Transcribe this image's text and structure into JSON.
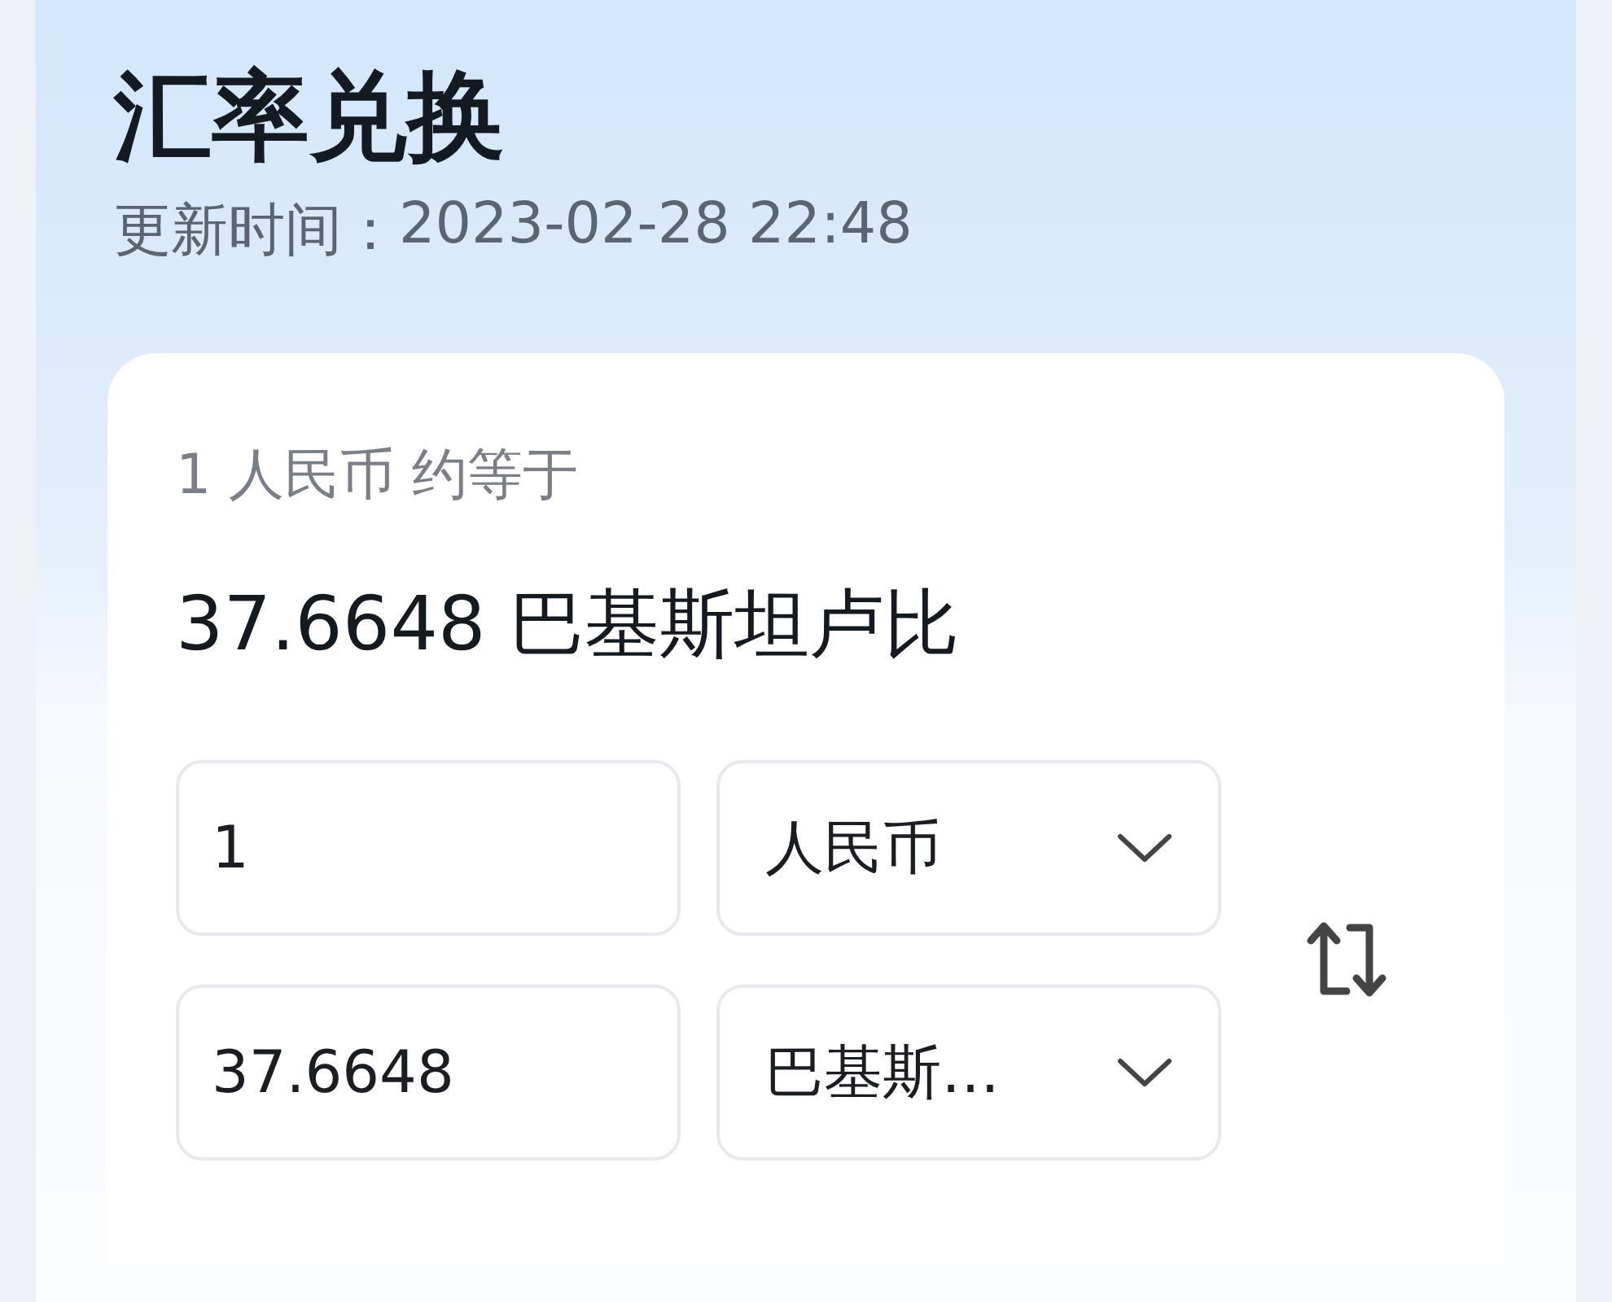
{
  "title": "汇率兑换",
  "updated": {
    "label": "更新时间：",
    "value": "2023-02-28 22:48"
  },
  "card": {
    "base": "1 人民币 约等于",
    "result": "37.6648 巴基斯坦卢比",
    "rows": [
      {
        "amount": "1",
        "currency": "人民币"
      },
      {
        "amount": "37.6648",
        "currency": "巴基斯…"
      }
    ]
  }
}
